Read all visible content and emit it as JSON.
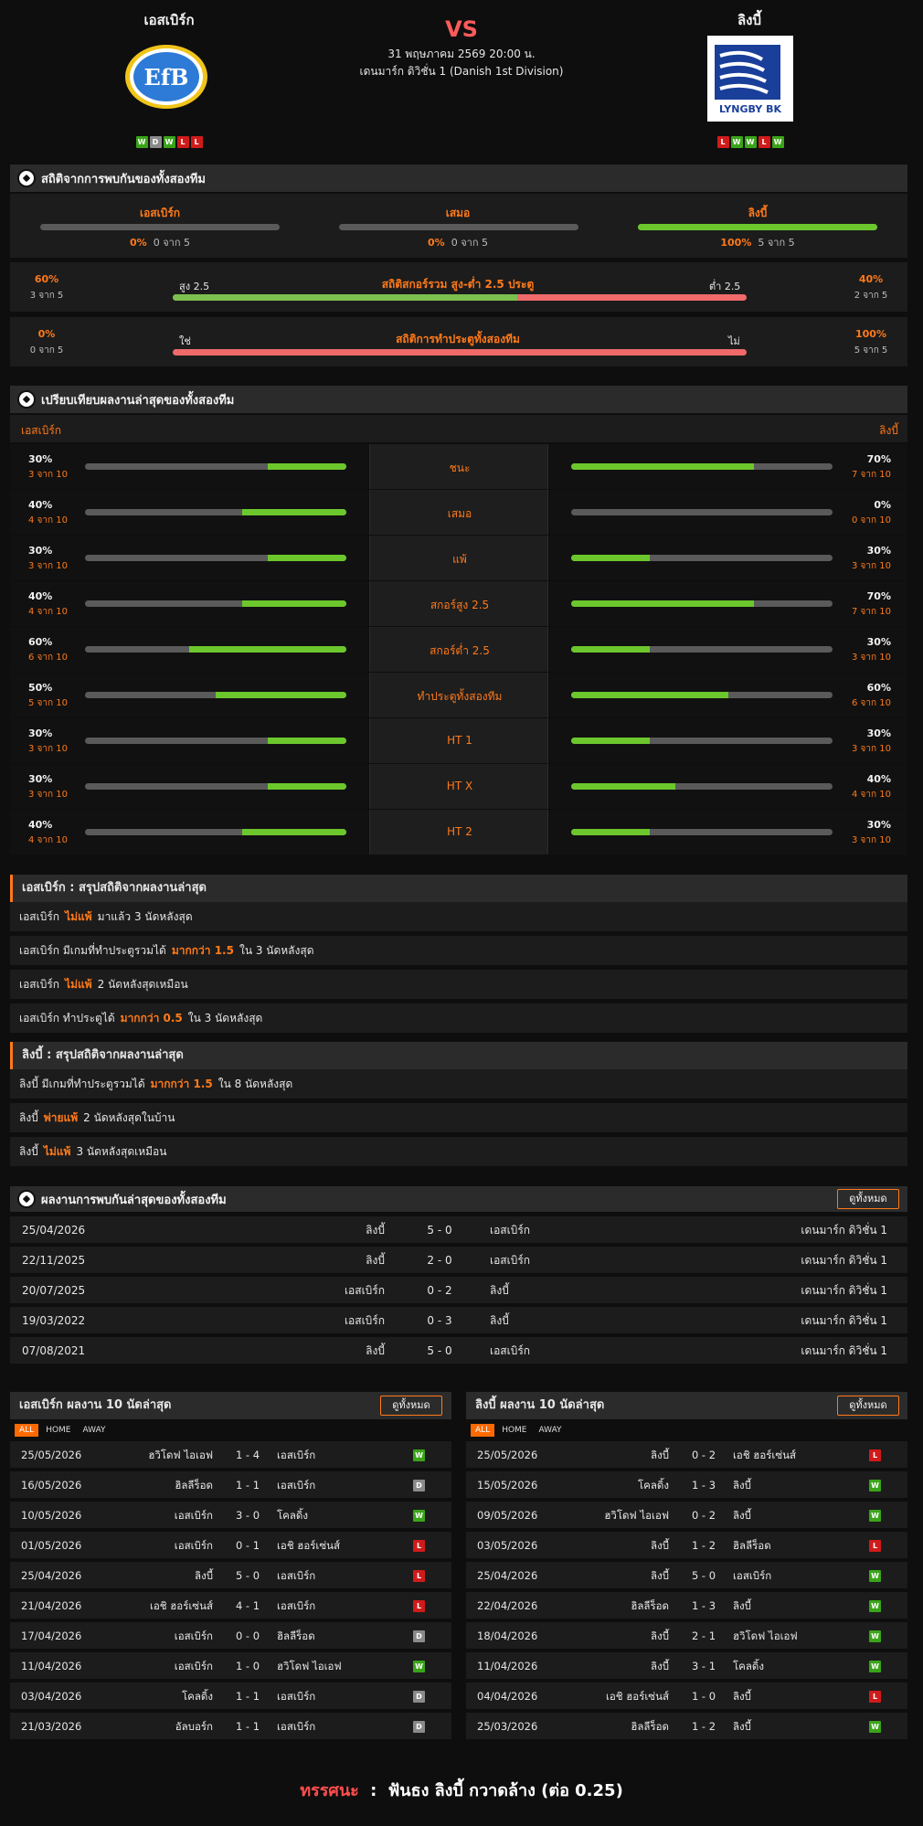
{
  "header": {
    "home_name": "เอสเบิร์ก",
    "away_name": "ลิงบี้",
    "vs": "VS",
    "datetime": "31 พฤษภาคม 2569 20:00 น.",
    "league": "เดนมาร์ก ดิวิชั่น 1 (Danish 1st Division)",
    "home_logo_text": "EfB",
    "away_logo_text": "LYNGBY BK",
    "home_form": [
      "W",
      "D",
      "W",
      "L",
      "L"
    ],
    "away_form": [
      "L",
      "W",
      "W",
      "L",
      "W"
    ]
  },
  "h2h_stats": {
    "title": "สถิติจากการพบกันของทั้งสองทีม",
    "cols": [
      {
        "label": "เอสเบิร์ก",
        "pct": "0%",
        "sub": "0 จาก 5",
        "fill": 0
      },
      {
        "label": "เสมอ",
        "pct": "0%",
        "sub": "0 จาก 5",
        "fill": 0
      },
      {
        "label": "ลิงบี้",
        "pct": "100%",
        "sub": "5 จาก 5",
        "fill": 1
      }
    ],
    "ou": {
      "left_pct": "60%",
      "left_sub": "3 จาก 5",
      "left_label": "สูง 2.5",
      "title": "สถิติสกอร์รวม สูง-ต่ำ 2.5 ประตู",
      "right_label": "ต่ำ 2.5",
      "right_pct": "40%",
      "right_sub": "2 จาก 5",
      "split": 0.6
    },
    "btts": {
      "left_pct": "0%",
      "left_sub": "0 จาก 5",
      "left_label": "ใช่",
      "title": "สถิติการทำประตูทั้งสองทีม",
      "right_label": "ไม่",
      "right_pct": "100%",
      "right_sub": "5 จาก 5",
      "split": 0
    }
  },
  "compare": {
    "title": "เปรียบเทียบผลงานล่าสุดของทั้งสองทีม",
    "home": "เอสเบิร์ก",
    "away": "ลิงบี้",
    "rows": [
      {
        "label": "ชนะ",
        "hp": "30%",
        "hs": "3 จาก 10",
        "hv": 0.3,
        "ap": "70%",
        "as": "7 จาก 10",
        "av": 0.7
      },
      {
        "label": "เสมอ",
        "hp": "40%",
        "hs": "4 จาก 10",
        "hv": 0.4,
        "ap": "0%",
        "as": "0 จาก 10",
        "av": 0
      },
      {
        "label": "แพ้",
        "hp": "30%",
        "hs": "3 จาก 10",
        "hv": 0.3,
        "ap": "30%",
        "as": "3 จาก 10",
        "av": 0.3
      },
      {
        "label": "สกอร์สูง 2.5",
        "hp": "40%",
        "hs": "4 จาก 10",
        "hv": 0.4,
        "ap": "70%",
        "as": "7 จาก 10",
        "av": 0.7
      },
      {
        "label": "สกอร์ต่ำ 2.5",
        "hp": "60%",
        "hs": "6 จาก 10",
        "hv": 0.6,
        "ap": "30%",
        "as": "3 จาก 10",
        "av": 0.3
      },
      {
        "label": "ทำประตูทั้งสองทีม",
        "hp": "50%",
        "hs": "5 จาก 10",
        "hv": 0.5,
        "ap": "60%",
        "as": "6 จาก 10",
        "av": 0.6
      },
      {
        "label": "HT 1",
        "hp": "30%",
        "hs": "3 จาก 10",
        "hv": 0.3,
        "ap": "30%",
        "as": "3 จาก 10",
        "av": 0.3
      },
      {
        "label": "HT X",
        "hp": "30%",
        "hs": "3 จาก 10",
        "hv": 0.3,
        "ap": "40%",
        "as": "4 จาก 10",
        "av": 0.4
      },
      {
        "label": "HT 2",
        "hp": "40%",
        "hs": "4 จาก 10",
        "hv": 0.4,
        "ap": "30%",
        "as": "3 จาก 10",
        "av": 0.3
      }
    ]
  },
  "home_summary": {
    "title": "เอสเบิร์ก : สรุปสถิติจากผลงานล่าสุด",
    "rows": [
      {
        "a": "เอสเบิร์ก",
        "b": "ไม่แพ้",
        "c": "มาแล้ว 3 นัดหลังสุด"
      },
      {
        "a": "เอสเบิร์ก มีเกมที่ทำประตูรวมได้",
        "b": "มากกว่า 1.5",
        "c": "ใน 3 นัดหลังสุด"
      },
      {
        "a": "เอสเบิร์ก",
        "b": "ไม่แพ้",
        "c": "2 นัดหลังสุดเหมือน"
      },
      {
        "a": "เอสเบิร์ก ทำประตูได้",
        "b": "มากกว่า 0.5",
        "c": "ใน 3 นัดหลังสุด"
      }
    ]
  },
  "away_summary": {
    "title": "ลิงบี้ : สรุปสถิติจากผลงานล่าสุด",
    "rows": [
      {
        "a": "ลิงบี้ มีเกมที่ทำประตูรวมได้",
        "b": "มากกว่า 1.5",
        "c": "ใน 8 นัดหลังสุด"
      },
      {
        "a": "ลิงบี้",
        "b": "พ่ายแพ้",
        "c": "2 นัดหลังสุดในบ้าน"
      },
      {
        "a": "ลิงบี้",
        "b": "ไม่แพ้",
        "c": "3 นัดหลังสุดเหมือน"
      }
    ]
  },
  "h2h": {
    "title": "ผลงานการพบกันล่าสุดของทั้งสองทีม",
    "view_all": "ดูทั้งหมด",
    "rows": [
      {
        "date": "25/04/2026",
        "home": "ลิงบี้",
        "score": "5 - 0",
        "away": "เอสเบิร์ก",
        "league": "เดนมาร์ก ดิวิชั่น 1"
      },
      {
        "date": "22/11/2025",
        "home": "ลิงบี้",
        "score": "2 - 0",
        "away": "เอสเบิร์ก",
        "league": "เดนมาร์ก ดิวิชั่น 1"
      },
      {
        "date": "20/07/2025",
        "home": "เอสเบิร์ก",
        "score": "0 - 2",
        "away": "ลิงบี้",
        "league": "เดนมาร์ก ดิวิชั่น 1"
      },
      {
        "date": "19/03/2022",
        "home": "เอสเบิร์ก",
        "score": "0 - 3",
        "away": "ลิงบี้",
        "league": "เดนมาร์ก ดิวิชั่น 1"
      },
      {
        "date": "07/08/2021",
        "home": "ลิงบี้",
        "score": "5 - 0",
        "away": "เอสเบิร์ก",
        "league": "เดนมาร์ก ดิวิชั่น 1"
      }
    ]
  },
  "home_recent": {
    "title": "เอสเบิร์ก ผลงาน 10 นัดล่าสุด",
    "view_all": "ดูทั้งหมด",
    "tabs": [
      "ALL",
      "HOME",
      "AWAY"
    ],
    "rows": [
      {
        "date": "25/05/2026",
        "home": "ฮวิโดฟ ไอเอฟ",
        "score": "1 - 4",
        "away": "เอสเบิร์ก",
        "r": "W"
      },
      {
        "date": "16/05/2026",
        "home": "ฮิลลีร็อด",
        "score": "1 - 1",
        "away": "เอสเบิร์ก",
        "r": "D"
      },
      {
        "date": "10/05/2026",
        "home": "เอสเบิร์ก",
        "score": "3 - 0",
        "away": "โคลดิ้ง",
        "r": "W"
      },
      {
        "date": "01/05/2026",
        "home": "เอสเบิร์ก",
        "score": "0 - 1",
        "away": "เอชิ ฮอร์เซ่นส์",
        "r": "L"
      },
      {
        "date": "25/04/2026",
        "home": "ลิงบี้",
        "score": "5 - 0",
        "away": "เอสเบิร์ก",
        "r": "L"
      },
      {
        "date": "21/04/2026",
        "home": "เอชิ ฮอร์เซ่นส์",
        "score": "4 - 1",
        "away": "เอสเบิร์ก",
        "r": "L"
      },
      {
        "date": "17/04/2026",
        "home": "เอสเบิร์ก",
        "score": "0 - 0",
        "away": "ฮิลลีร็อด",
        "r": "D"
      },
      {
        "date": "11/04/2026",
        "home": "เอสเบิร์ก",
        "score": "1 - 0",
        "away": "ฮวิโดฟ ไอเอฟ",
        "r": "W"
      },
      {
        "date": "03/04/2026",
        "home": "โคลดิ้ง",
        "score": "1 - 1",
        "away": "เอสเบิร์ก",
        "r": "D"
      },
      {
        "date": "21/03/2026",
        "home": "อัลบอร์ก",
        "score": "1 - 1",
        "away": "เอสเบิร์ก",
        "r": "D"
      }
    ]
  },
  "away_recent": {
    "title": "ลิงบี้ ผลงาน 10 นัดล่าสุด",
    "view_all": "ดูทั้งหมด",
    "tabs": [
      "ALL",
      "HOME",
      "AWAY"
    ],
    "rows": [
      {
        "date": "25/05/2026",
        "home": "ลิงบี้",
        "score": "0 - 2",
        "away": "เอชิ ฮอร์เซ่นส์",
        "r": "L"
      },
      {
        "date": "15/05/2026",
        "home": "โคลดิ้ง",
        "score": "1 - 3",
        "away": "ลิงบี้",
        "r": "W"
      },
      {
        "date": "09/05/2026",
        "home": "ฮวิโดฟ ไอเอฟ",
        "score": "0 - 2",
        "away": "ลิงบี้",
        "r": "W"
      },
      {
        "date": "03/05/2026",
        "home": "ลิงบี้",
        "score": "1 - 2",
        "away": "ฮิลลีร็อด",
        "r": "L"
      },
      {
        "date": "25/04/2026",
        "home": "ลิงบี้",
        "score": "5 - 0",
        "away": "เอสเบิร์ก",
        "r": "W"
      },
      {
        "date": "22/04/2026",
        "home": "ฮิลลีร็อด",
        "score": "1 - 3",
        "away": "ลิงบี้",
        "r": "W"
      },
      {
        "date": "18/04/2026",
        "home": "ลิงบี้",
        "score": "2 - 1",
        "away": "ฮวิโดฟ ไอเอฟ",
        "r": "W"
      },
      {
        "date": "11/04/2026",
        "home": "ลิงบี้",
        "score": "3 - 1",
        "away": "โคลดิ้ง",
        "r": "W"
      },
      {
        "date": "04/04/2026",
        "home": "เอชิ ฮอร์เซ่นส์",
        "score": "1 - 0",
        "away": "ลิงบี้",
        "r": "L"
      },
      {
        "date": "25/03/2026",
        "home": "ฮิลลีร็อด",
        "score": "1 - 2",
        "away": "ลิงบี้",
        "r": "W"
      }
    ]
  },
  "prediction": {
    "label": "ทรรศนะ",
    "colon": ":",
    "text": "ฟันธง ลิงบี้ กวาดล้าง (ต่อ 0.25)"
  },
  "colors": {
    "accent": "#ff7a1a",
    "win": "#3aa419",
    "draw": "#8a8a8a",
    "loss": "#d01b1b",
    "bar_green": "#6cc72c",
    "bar_red": "#f06a6a"
  }
}
